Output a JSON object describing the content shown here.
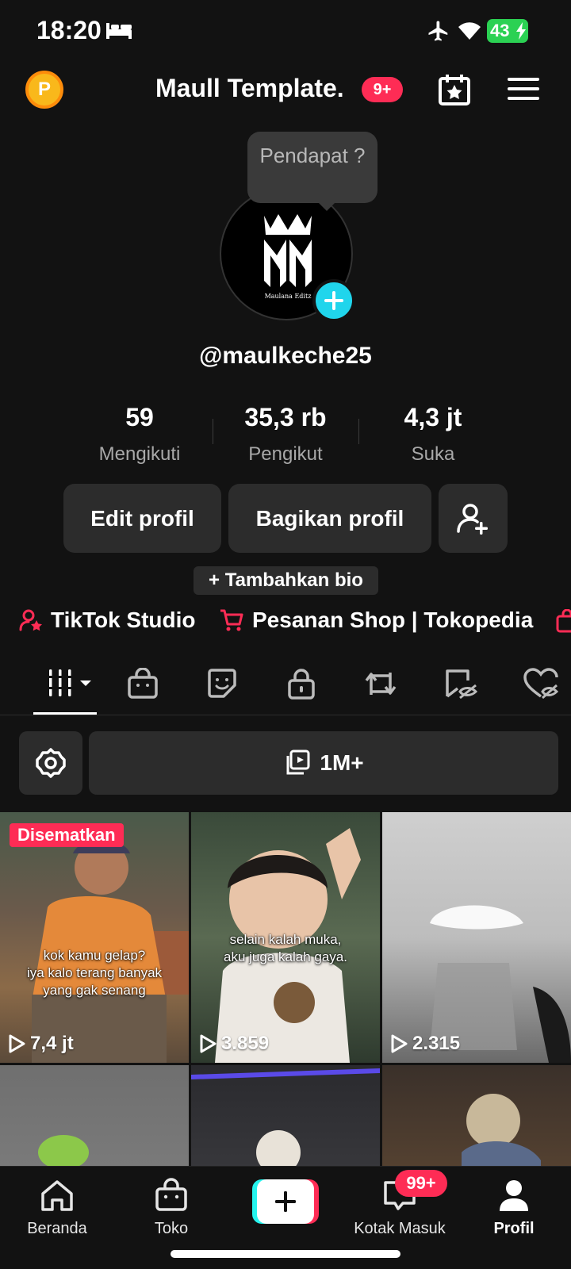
{
  "status_bar": {
    "time": "18:20",
    "battery": "43"
  },
  "header": {
    "title": "Maull Template.",
    "notification_badge": "9+",
    "coin_letter": "P"
  },
  "profile": {
    "tooltip": "Pendapat ?",
    "avatar_text": "Maulana Editz",
    "username": "@maulkeche25",
    "stats": [
      {
        "value": "59",
        "label": "Mengikuti"
      },
      {
        "value": "35,3 rb",
        "label": "Pengikut"
      },
      {
        "value": "4,3 jt",
        "label": "Suka"
      }
    ],
    "edit_label": "Edit profil",
    "share_label": "Bagikan profil",
    "bio_label": "+ Tambahkan bio"
  },
  "links": {
    "studio": "TikTok Studio",
    "shop": "Pesanan Shop | Tokopedia"
  },
  "filter": {
    "collections_label": "1M+"
  },
  "videos": [
    {
      "views": "7,4 jt",
      "pinned_label": "Disematkan",
      "caption": "kok kamu gelap?\niya kalo terang banyak\nyang gak senang"
    },
    {
      "views": "3.859",
      "caption": "selain kalah muka,\naku juga kalah gaya."
    },
    {
      "views": "2.315",
      "caption": ""
    },
    {
      "views": ""
    },
    {
      "views": ""
    },
    {
      "views": ""
    }
  ],
  "nav": {
    "home": "Beranda",
    "shop": "Toko",
    "inbox": "Kotak Masuk",
    "inbox_badge": "99+",
    "profile": "Profil"
  },
  "colors": {
    "accent": "#fe2c55",
    "cyan": "#25f4ee",
    "background": "#121212",
    "button": "#2c2c2c"
  }
}
